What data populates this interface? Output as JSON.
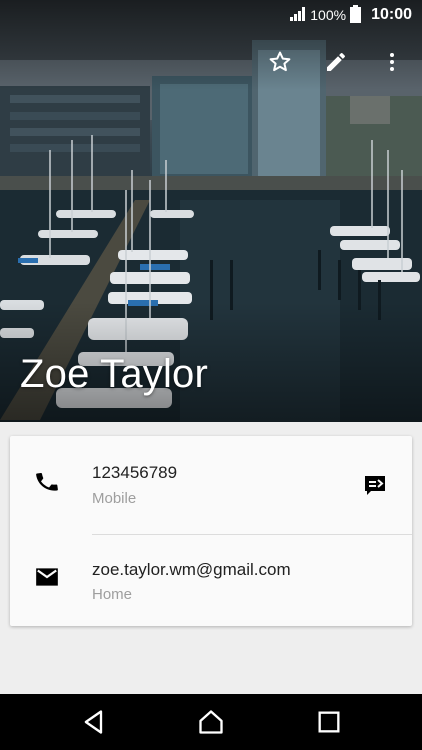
{
  "status_bar": {
    "battery_percent": "100%",
    "time": "10:00",
    "icons": [
      "signal-icon",
      "battery-icon"
    ]
  },
  "toolbar": {
    "actions": [
      "star-icon",
      "edit-pencil-icon",
      "more-vert-icon"
    ]
  },
  "contact": {
    "name": "Zoe Taylor",
    "phone": {
      "number": "123456789",
      "type": "Mobile",
      "icon": "phone-icon",
      "action_icon": "message-icon"
    },
    "email": {
      "address": "zoe.taylor.wm@gmail.com",
      "type": "Home",
      "icon": "email-icon"
    }
  },
  "nav_bar": {
    "buttons": [
      "back-icon",
      "home-icon",
      "recents-icon"
    ]
  },
  "colors": {
    "card_bg": "#fafafa",
    "page_bg": "#eeeeee",
    "primary_text": "#212121",
    "secondary_text": "#9e9e9e",
    "nav_bg": "#000000"
  }
}
